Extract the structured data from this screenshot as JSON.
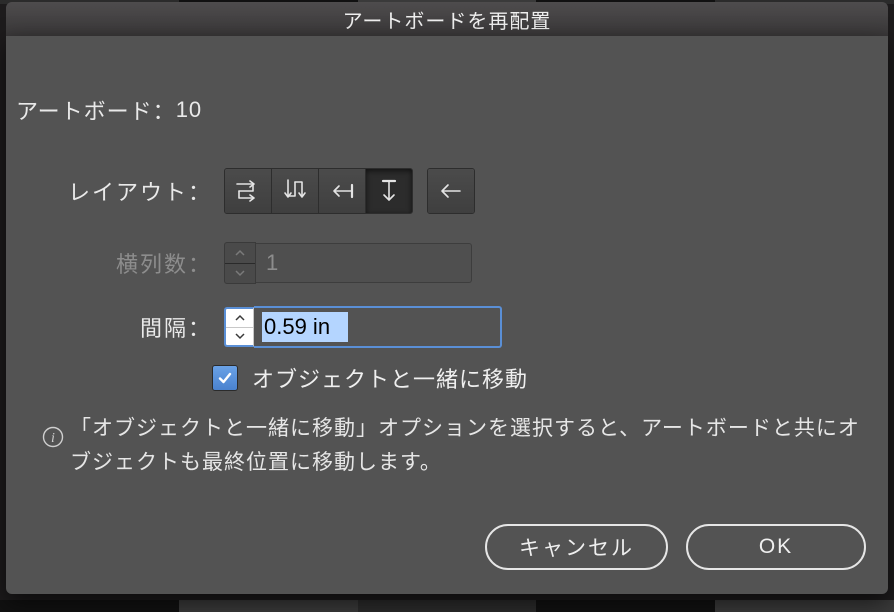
{
  "window": {
    "title": "アートボードを再配置"
  },
  "content": {
    "artboards_prefix": "アートボード：",
    "artboards_count": "10",
    "layout_label": "レイアウト：",
    "layout_options": [
      "grid-by-row",
      "grid-by-column",
      "row-rtl",
      "column",
      "row-ltr"
    ],
    "layout_selected_index": 3,
    "columns_label": "横列数：",
    "columns_value": "1",
    "columns_enabled": false,
    "spacing_label": "間隔：",
    "spacing_value": "0.59 in",
    "move_artwork_checked": true,
    "move_artwork_label": "オブジェクトと一緒に移動",
    "info_text": "「オブジェクトと一緒に移動」オプションを選択すると、アートボードと共にオブジェクトも最終位置に移動します。"
  },
  "footer": {
    "cancel": "キャンセル",
    "ok": "OK"
  }
}
